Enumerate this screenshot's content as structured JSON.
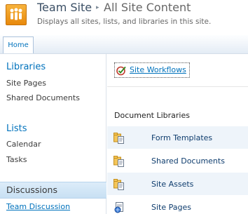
{
  "header": {
    "site_title": "Team Site",
    "separator": "▸",
    "page_title": "All Site Content",
    "description": "Displays all sites, lists, and libraries in this site."
  },
  "topnav": {
    "home_tab": "Home"
  },
  "leftnav": {
    "libraries_heading": "Libraries",
    "libraries": [
      "Site Pages",
      "Shared Documents"
    ],
    "lists_heading": "Lists",
    "lists": [
      "Calendar",
      "Tasks"
    ],
    "discussions_heading": "Discussions",
    "discussions": [
      "Team Discussion"
    ]
  },
  "main": {
    "workflows_link": "Site Workflows",
    "doc_libraries_heading": "Document Libraries",
    "libraries": [
      {
        "label": "Form Templates",
        "icon": "document-library-icon"
      },
      {
        "label": "Shared Documents",
        "icon": "document-library-icon"
      },
      {
        "label": "Site Assets",
        "icon": "document-library-icon"
      },
      {
        "label": "Site Pages",
        "icon": "wiki-page-library-icon"
      }
    ]
  },
  "colors": {
    "link_blue": "#0072bc",
    "logo_orange": "#f29b1d",
    "selected_nav_bg": "#d3e7f7"
  }
}
